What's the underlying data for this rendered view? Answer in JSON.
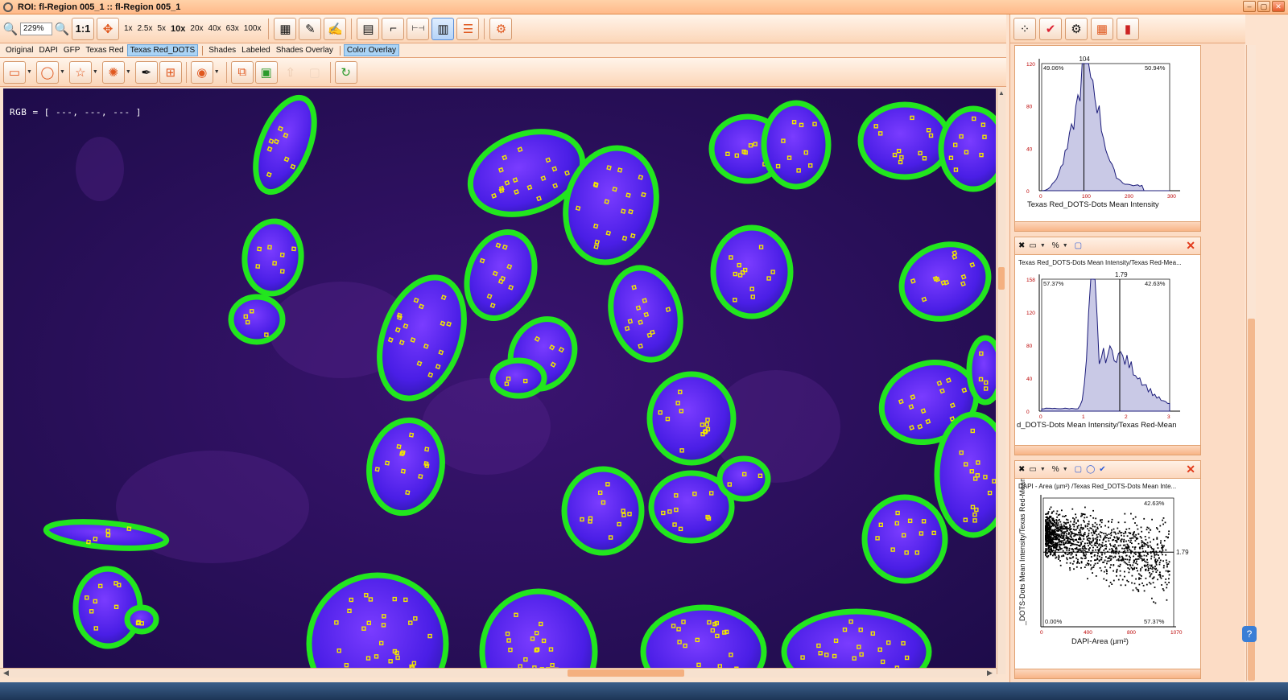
{
  "window": {
    "title": "ROI: fl-Region 005_1 :: fl-Region 005_1",
    "minimize": "–",
    "maximize": "▢",
    "close": "✕"
  },
  "toolbar": {
    "zoom_value": "229%",
    "fit_label": "1:1",
    "zoom_presets": [
      "1x",
      "2.5x",
      "5x",
      "10x",
      "20x",
      "40x",
      "63x",
      "100x"
    ],
    "active_zoom": "10x"
  },
  "channel_tabs": [
    "Original",
    "DAPI",
    "GFP",
    "Texas Red",
    "Texas Red_DOTS",
    "Shades",
    "Labeled",
    "Shades Overlay",
    "Color Overlay"
  ],
  "selected_tabs": [
    "Texas Red_DOTS",
    "Color Overlay"
  ],
  "viewer": {
    "rgb_readout": "RGB = [ ---, ---, --- ]",
    "outline_color": "#22e61e",
    "dot_color": "#f2e600",
    "nucleus_color": "#4a20e0",
    "background_color": "#2a1258"
  },
  "charts_panel": {
    "histogram1": {
      "title": "Texas Red_DOTS-Dots Mean Intensity",
      "xlabel": "Texas Red_DOTS-Dots Mean Intensity",
      "gate_value": "104",
      "left_pct": "49.06%",
      "right_pct": "50.94%",
      "y_ticks": [
        "120",
        "80",
        "40",
        "0"
      ],
      "x_ticks": [
        "0",
        "100",
        "200",
        "300"
      ]
    },
    "histogram2": {
      "title": "Texas Red_DOTS-Dots Mean Intensity/Texas Red-Mea...",
      "xlabel": "d_DOTS-Dots Mean Intensity/Texas Red-Mean",
      "gate_value": "1.79",
      "left_pct": "57.37%",
      "right_pct": "42.63%",
      "y_ticks": [
        "158",
        "120",
        "80",
        "40",
        "0"
      ],
      "x_ticks": [
        "0",
        "1",
        "2",
        "3"
      ]
    },
    "scatter": {
      "title": "DAPI - Area (µm²) /Texas Red_DOTS-Dots Mean Inte...",
      "xlabel": "DAPI-Area (µm²)",
      "ylabel": "_DOTS-Dots Mean Intensity/Texas Red-Mean",
      "gate_value": "1.79",
      "top_right_pct": "42.63%",
      "bottom_left_pct": "0.00%",
      "bottom_right_pct": "57.37%",
      "x_ticks": [
        "0",
        "400",
        "800",
        "1070"
      ]
    },
    "panel_percent_label": "%"
  }
}
